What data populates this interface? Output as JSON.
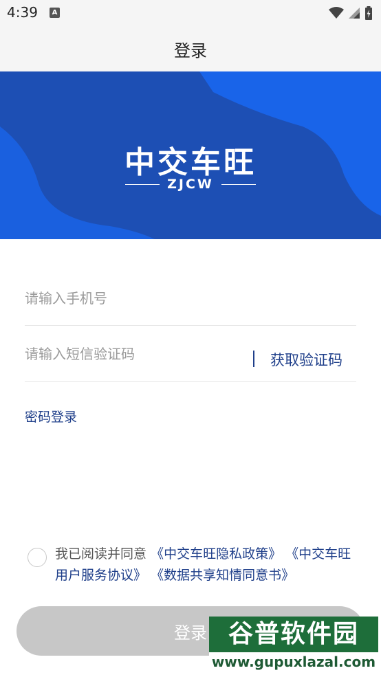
{
  "status_bar": {
    "time": "4:39",
    "notification_icon": "A"
  },
  "header": {
    "title": "登录"
  },
  "banner": {
    "brand_name": "中交车旺",
    "brand_sub": "ZJCW",
    "colors": {
      "base": "#1d4fb4",
      "wave": "#1a66ee"
    }
  },
  "form": {
    "phone_placeholder": "请输入手机号",
    "phone_value": "",
    "code_placeholder": "请输入短信验证码",
    "code_value": "",
    "get_code_label": "获取验证码",
    "password_login_label": "密码登录"
  },
  "agreement": {
    "checked": false,
    "prefix": "我已阅读并同意",
    "privacy_policy": "《中交车旺隐私政策》",
    "user_agreement": "《中交车旺用户服务协议》",
    "data_sharing": "《数据共享知情同意书》"
  },
  "login_button": {
    "label": "登录"
  },
  "watermark": {
    "brand": "谷普软件园",
    "url": "www.gupuxlazal.com"
  },
  "colors": {
    "accent": "#1f3f8a",
    "button_disabled": "#c7c7c7"
  }
}
